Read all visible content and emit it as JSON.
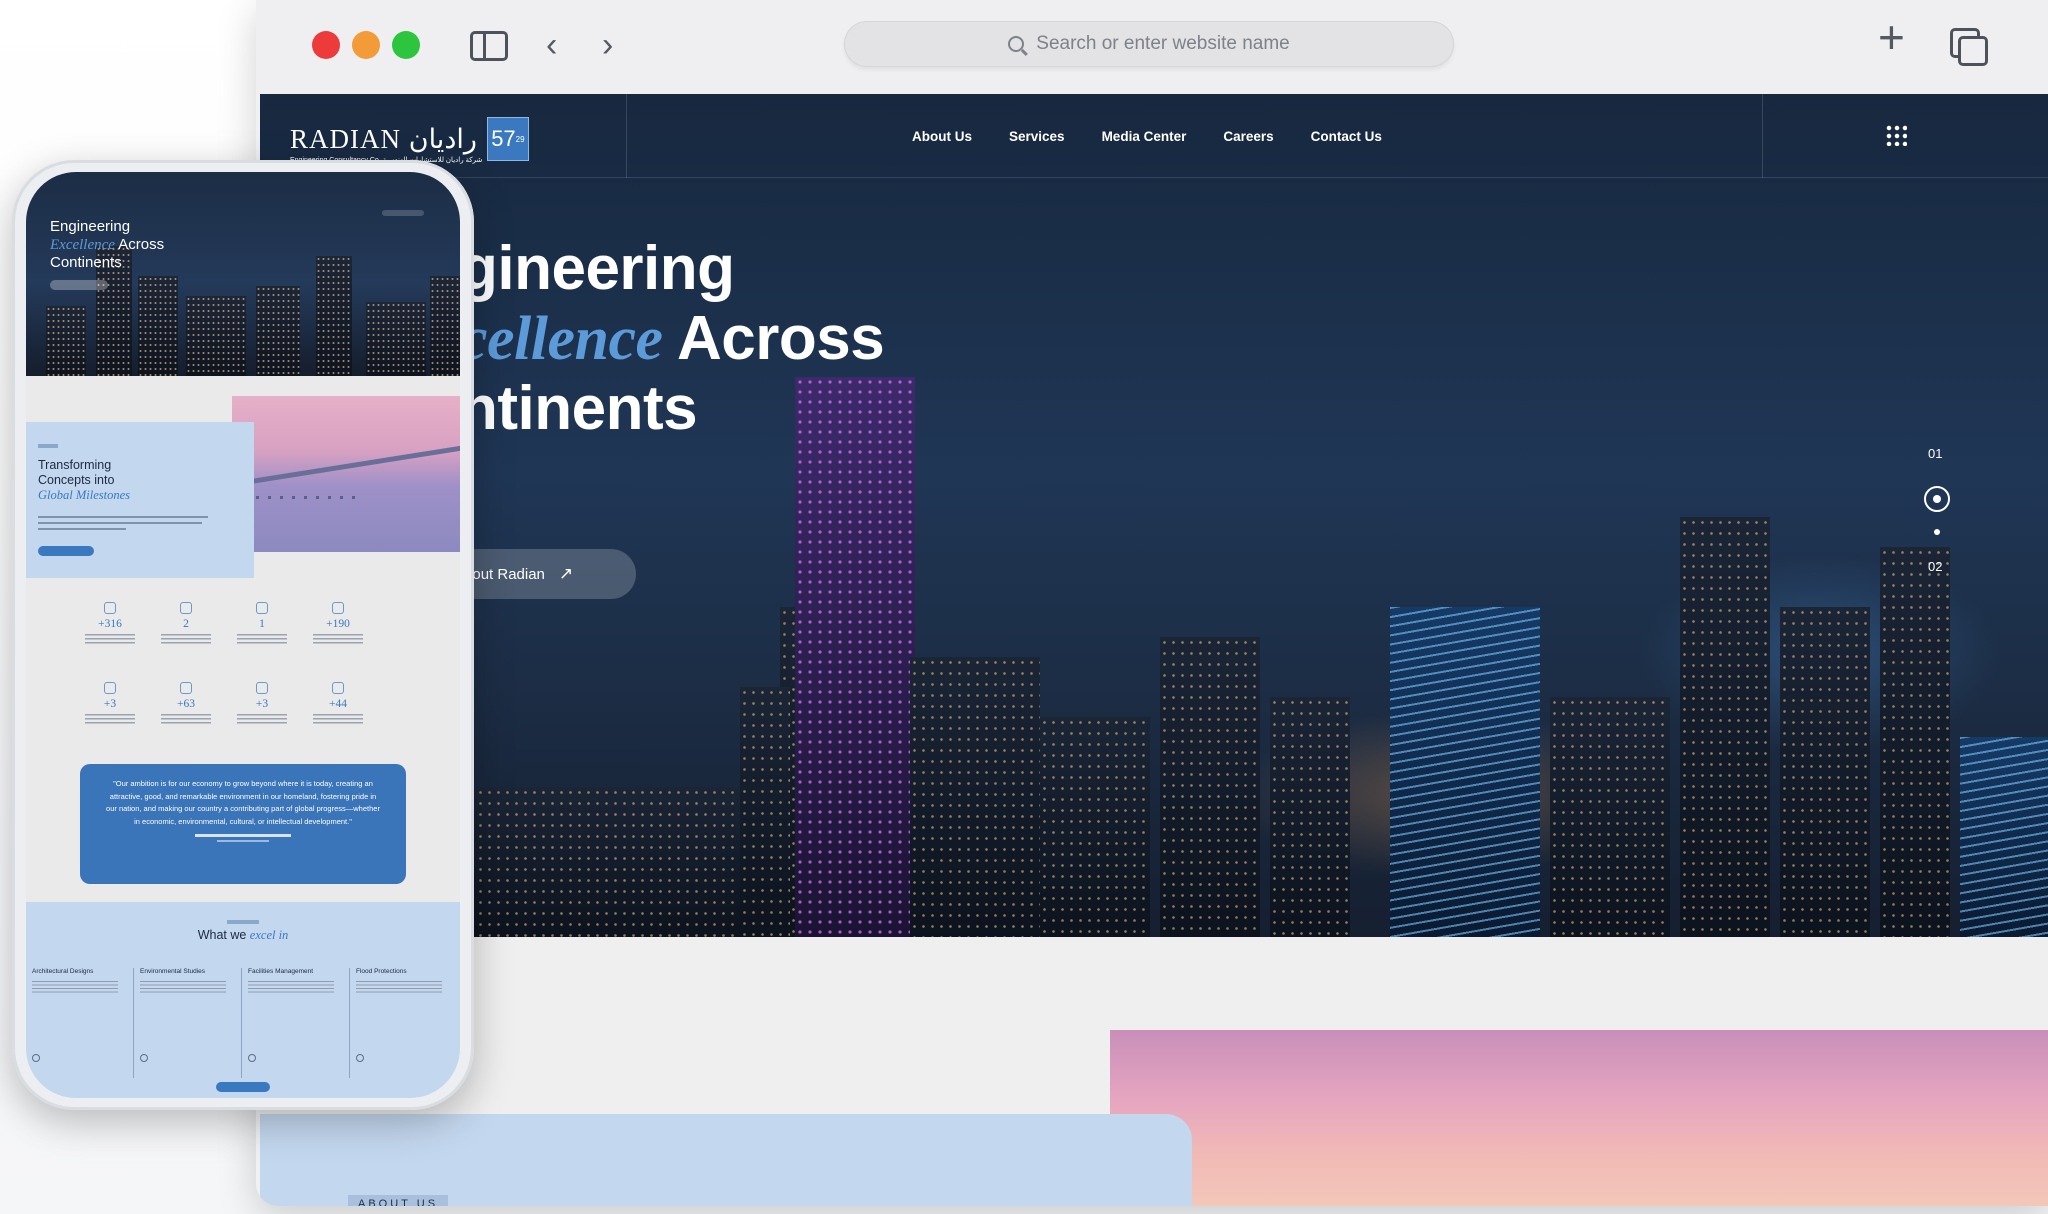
{
  "browser": {
    "address_placeholder": "Search or enter website name",
    "back_glyph": "‹",
    "forward_glyph": "›",
    "new_tab_glyph": "+"
  },
  "site": {
    "logo": {
      "name": "RADIAN راديان",
      "subtitle": "Engineering Consultancy Co. شركة راديان للاستشارات الهندسية",
      "badge": "57",
      "badge_sup": "29"
    },
    "nav": [
      "About Us",
      "Services",
      "Media Center",
      "Careers",
      "Contact Us"
    ],
    "hero": {
      "title_line1": "gineering",
      "title_line2_accent": "cellence",
      "title_line2_rest": " Across",
      "title_line3": "ntinents",
      "button": "About Radian",
      "button_arrow": "↗",
      "pager": [
        "01",
        "02"
      ]
    },
    "about_tag": "ABOUT US"
  },
  "mobile": {
    "hero": {
      "line1": "Engineering",
      "line2_accent": "Excellence",
      "line2_rest": " Across",
      "line3": "Continents"
    },
    "about": {
      "line1": "Transforming",
      "line2": "Concepts into",
      "line3_accent": "Global Milestones"
    },
    "stats": [
      "+316",
      "2",
      "1",
      "+190",
      "+3",
      "+63",
      "+3",
      "+44"
    ],
    "quote": "\"Our ambition is for our economy to grow beyond where it is today, creating an attractive, good, and remarkable environment in our homeland, fostering pride in our nation, and making our country a contributing part of global progress—whether in economic, environmental, cultural, or intellectual development.\"",
    "services_title": "What we ",
    "services_title_accent": "excel in",
    "services": [
      "Architectural Designs",
      "Environmental Studies",
      "Facilities Management",
      "Flood Protections"
    ]
  },
  "colors": {
    "accent": "#3a78bf",
    "hero_bg": "#1f3655",
    "light_band": "#c3d7ee"
  }
}
